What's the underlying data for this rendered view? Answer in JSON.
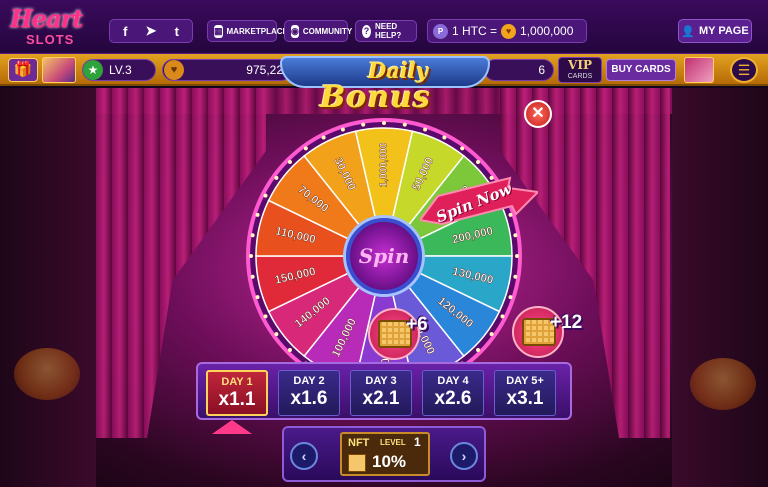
{
  "nav": {
    "logo_top": "Heart",
    "logo_bottom": "SLOTS",
    "social": [
      "f",
      "➤",
      "t"
    ],
    "marketplace": "MARKETPLACE",
    "community": "COMMUNITY",
    "need_help": "NEED HELP?",
    "rate_left": "1 HTC =",
    "rate_right": "1,000,000",
    "my_page": "MY PAGE"
  },
  "status": {
    "level": "LV.3",
    "coins": "975,22",
    "tickets": "6",
    "vip": "VIP",
    "vip_sub": "CARDS",
    "buy_cards": "BUY CARDS"
  },
  "bonus": {
    "title_top": "Daily",
    "title_bottom": "Bonus",
    "spin_label": "Spin",
    "spin_now": "Spin Now"
  },
  "wheel_values": [
    "1,000,000",
    "50,000",
    "90,000",
    "200,000",
    "130,000",
    "120,000",
    "80,000",
    "60,000",
    "100,000",
    "140,000",
    "150,000",
    "110,000",
    "70,000",
    "30,000"
  ],
  "badges": [
    {
      "plus": "+6"
    },
    {
      "plus": "+12"
    }
  ],
  "days": [
    {
      "label": "DAY 1",
      "mult": "x1.1",
      "active": true
    },
    {
      "label": "DAY 2",
      "mult": "x1.6",
      "active": false
    },
    {
      "label": "DAY 3",
      "mult": "x2.1",
      "active": false
    },
    {
      "label": "DAY 4",
      "mult": "x2.6",
      "active": false
    },
    {
      "label": "DAY 5+",
      "mult": "x3.1",
      "active": false
    }
  ],
  "nft": {
    "label": "NFT",
    "level_label": "LEVEL",
    "level_value": "1",
    "percent": "10%"
  },
  "colors": {
    "wheel": [
      "#f2c21a",
      "#c6d82a",
      "#7cc83a",
      "#3ab85a",
      "#2aa6c8",
      "#2a86d8",
      "#6a5ad8",
      "#8a3ad0",
      "#b82ab8",
      "#d8287a",
      "#e02a3a",
      "#e8501e",
      "#f07a1a",
      "#f2a21a"
    ]
  }
}
